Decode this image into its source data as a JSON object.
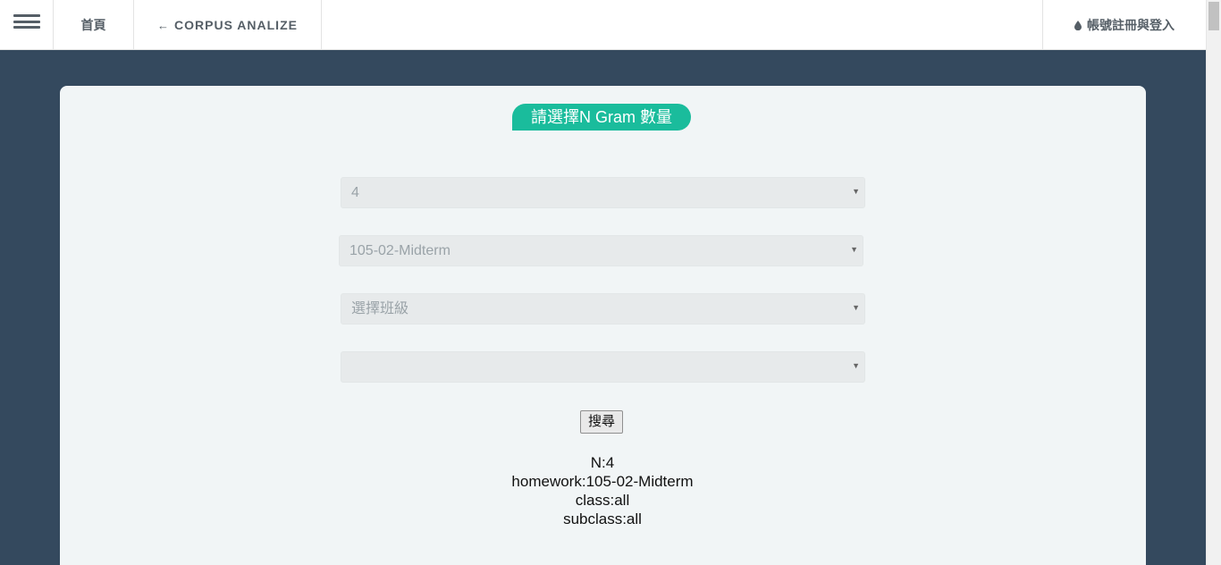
{
  "nav": {
    "home_label": "首頁",
    "back_arrow": "🡐",
    "back_label": "CORPUS ANALIZE",
    "account_label": "帳號註冊與登入"
  },
  "icons": {
    "menu": "hamburger-icon",
    "back": "arrow-left-icon",
    "account": "drop-icon"
  },
  "card": {
    "title": "請選擇N Gram 數量"
  },
  "form": {
    "ngram_value": "4",
    "homework_value": "105-02-Midterm",
    "class_placeholder": "選擇班級",
    "subclass_value": "",
    "search_label": "搜尋"
  },
  "result": {
    "n": "N:4",
    "homework": "homework:105-02-Midterm",
    "class": "class:all",
    "subclass": "subclass:all"
  },
  "colors": {
    "background": "#34495e",
    "accent": "#1abc9c",
    "card": "#f1f5f6"
  }
}
